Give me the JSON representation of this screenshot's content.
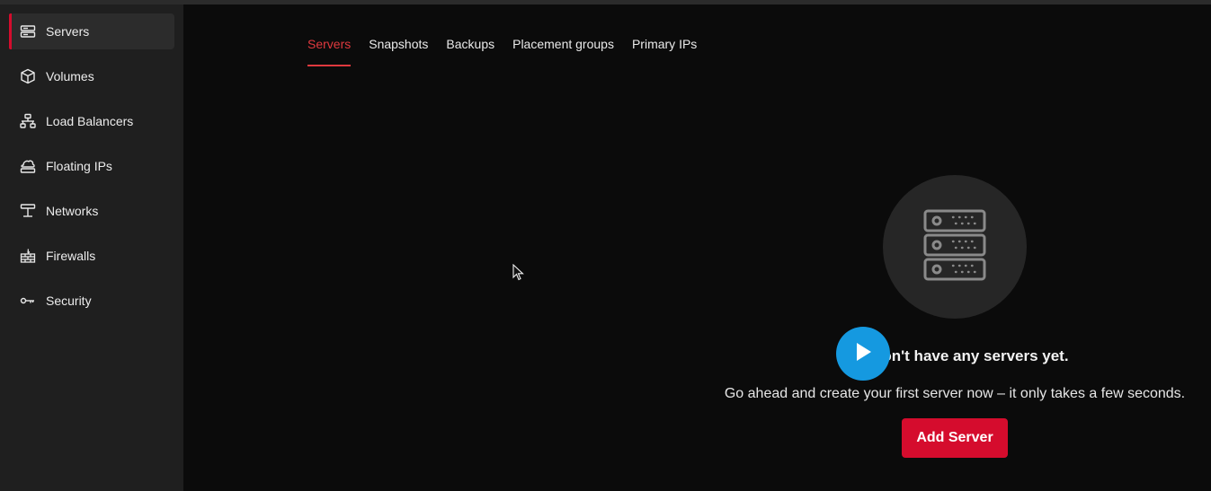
{
  "sidebar": {
    "items": [
      {
        "label": "Servers",
        "icon": "server-icon",
        "active": true
      },
      {
        "label": "Volumes",
        "icon": "volume-icon",
        "active": false
      },
      {
        "label": "Load Balancers",
        "icon": "load-balancer-icon",
        "active": false
      },
      {
        "label": "Floating IPs",
        "icon": "floating-ip-icon",
        "active": false
      },
      {
        "label": "Networks",
        "icon": "network-icon",
        "active": false
      },
      {
        "label": "Firewalls",
        "icon": "firewall-icon",
        "active": false
      },
      {
        "label": "Security",
        "icon": "key-icon",
        "active": false
      }
    ]
  },
  "tabs": [
    {
      "label": "Servers",
      "active": true
    },
    {
      "label": "Snapshots",
      "active": false
    },
    {
      "label": "Backups",
      "active": false
    },
    {
      "label": "Placement groups",
      "active": false
    },
    {
      "label": "Primary IPs",
      "active": false
    }
  ],
  "empty_state": {
    "icon": "server-rack-icon",
    "title": "You don't have any servers yet.",
    "subtitle": "Go ahead and create your first server now – it only takes a few seconds.",
    "button_label": "Add Server"
  },
  "overlay": {
    "icon": "play-icon"
  },
  "colors": {
    "accent": "#d50c2d",
    "sidebar_bg": "#1f1f1f",
    "main_bg": "#0b0b0b",
    "play_overlay": "#1599e0"
  }
}
